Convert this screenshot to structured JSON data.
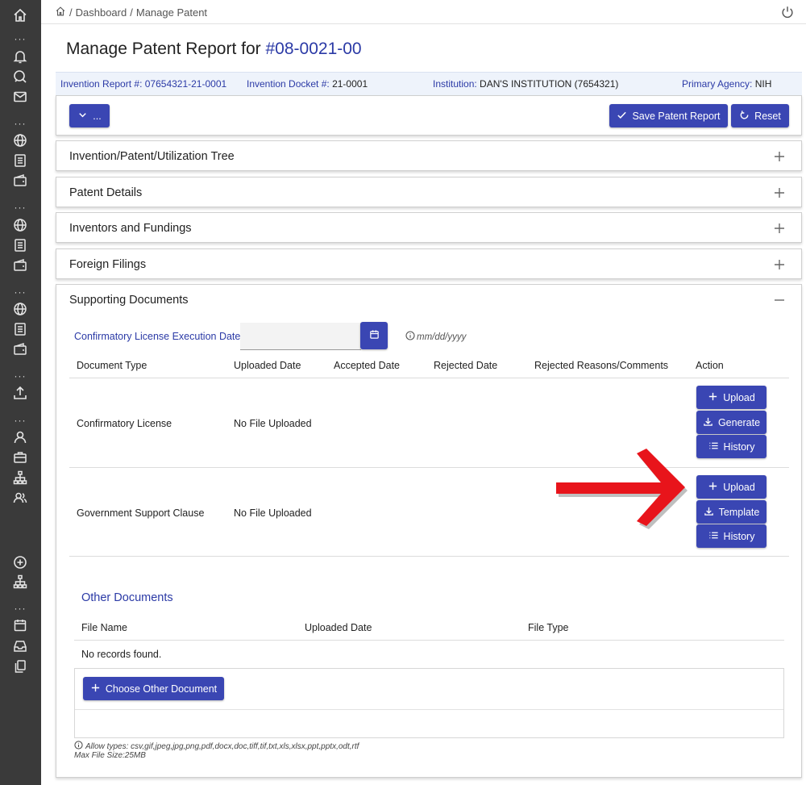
{
  "breadcrumb": {
    "dashboard": "Dashboard",
    "current": "Manage Patent",
    "sep": "/"
  },
  "title": {
    "prefix": "Manage Patent Report for",
    "number": "#08-0021-00"
  },
  "info": {
    "invention_report_label": "Invention Report #:",
    "invention_report_value": "07654321-21-0001",
    "docket_label": "Invention Docket #:",
    "docket_value": "21-0001",
    "institution_label": "Institution:",
    "institution_value": "DAN'S INSTITUTION (7654321)",
    "agency_label": "Primary Agency:",
    "agency_value": "NIH"
  },
  "toolbar": {
    "more_label": "...",
    "save_label": "Save Patent Report",
    "reset_label": "Reset"
  },
  "accordions": [
    {
      "title": "Invention/Patent/Utilization Tree",
      "expanded": false
    },
    {
      "title": "Patent Details",
      "expanded": false
    },
    {
      "title": "Inventors and Fundings",
      "expanded": false
    },
    {
      "title": "Foreign Filings",
      "expanded": false
    },
    {
      "title": "Supporting Documents",
      "expanded": true
    }
  ],
  "supporting": {
    "conf_date_label": "Confirmatory License Execution Date",
    "conf_date_value": "",
    "date_hint": "mm/dd/yyyy",
    "columns": [
      "Document Type",
      "Uploaded Date",
      "Accepted Date",
      "Rejected Date",
      "Rejected Reasons/Comments",
      "Action"
    ],
    "rows": [
      {
        "type": "Confirmatory License",
        "uploaded": "No File Uploaded",
        "actions": [
          "Upload",
          "Generate",
          "History"
        ]
      },
      {
        "type": "Government Support Clause",
        "uploaded": "No File Uploaded",
        "actions": [
          "Upload",
          "Template",
          "History"
        ]
      }
    ]
  },
  "other_documents": {
    "title": "Other Documents",
    "columns": [
      "File Name",
      "Uploaded Date",
      "File Type"
    ],
    "empty_text": "No records found.",
    "choose_label": "Choose Other Document",
    "allow_types": "Allow types: csv,gif,jpeg,jpg,png,pdf,docx,doc,tiff,tif,txt,xls,xlsx,ppt,pptx,odt,rtf",
    "max_size": "Max File Size:25MB"
  },
  "colors": {
    "primary": "#3a46b3",
    "link": "#2b3aa6",
    "sidebar": "#3a3a3a",
    "arrow": "#e8141b"
  }
}
